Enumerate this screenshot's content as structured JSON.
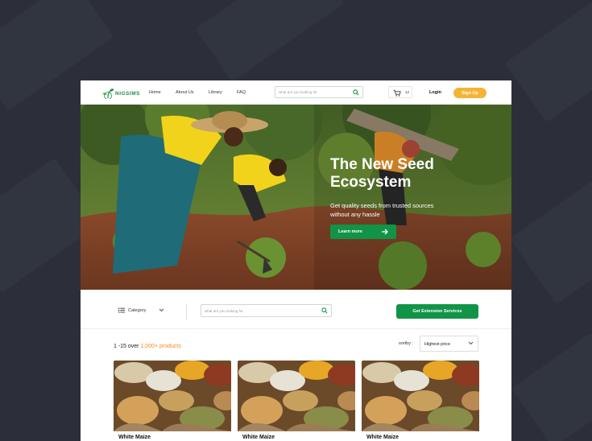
{
  "header": {
    "logo_text": "NIGSIMS",
    "nav": [
      "Home",
      "About Us",
      "Library",
      "FAQ"
    ],
    "search_placeholder": "what are you looking for",
    "cart_count": "12",
    "login_label": "Login",
    "signup_label": "Sign Up"
  },
  "hero": {
    "title": "The New Seed Ecosystem",
    "subtitle": "Get quality seeds from trusted sources without any hassle",
    "cta_label": "Learn more"
  },
  "filter": {
    "category_label": "Category",
    "search_placeholder": "what are you looking for",
    "extension_label": "Get Extension Services"
  },
  "products": {
    "count_prefix": "1 -15 over ",
    "count_highlight": "1,000+ products",
    "sort_label": "sortby :",
    "sort_value": "Highest price",
    "items": [
      {
        "name": "White Maize"
      },
      {
        "name": "White Maize"
      },
      {
        "name": "White Maize"
      }
    ]
  },
  "colors": {
    "brand_green": "#119447",
    "accent_orange": "#f5b435",
    "background": "#2c2f3a"
  }
}
